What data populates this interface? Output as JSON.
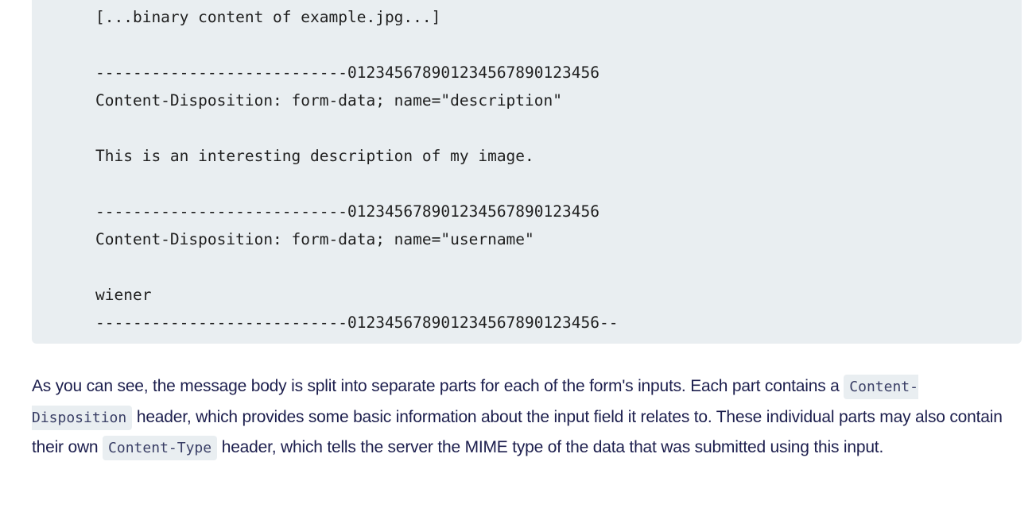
{
  "code_block": {
    "lines": [
      "[...binary content of example.jpg...]",
      "",
      "---------------------------012345678901234567890123456",
      "Content-Disposition: form-data; name=\"description\"",
      "",
      "This is an interesting description of my image.",
      "",
      "---------------------------012345678901234567890123456",
      "Content-Disposition: form-data; name=\"username\"",
      "",
      "wiener",
      "---------------------------012345678901234567890123456--"
    ]
  },
  "paragraph": {
    "text_1": "As you can see, the message body is split into separate parts for each of the form's inputs. Each part contains a ",
    "code_1a": "Content-",
    "code_1b": "Disposition",
    "text_2": " header, which provides some basic information about the input field it relates to. These individual parts may also contain their own ",
    "code_2": "Content-Type",
    "text_3": " header, which tells the server the MIME type of the data that was submitted using this input."
  }
}
